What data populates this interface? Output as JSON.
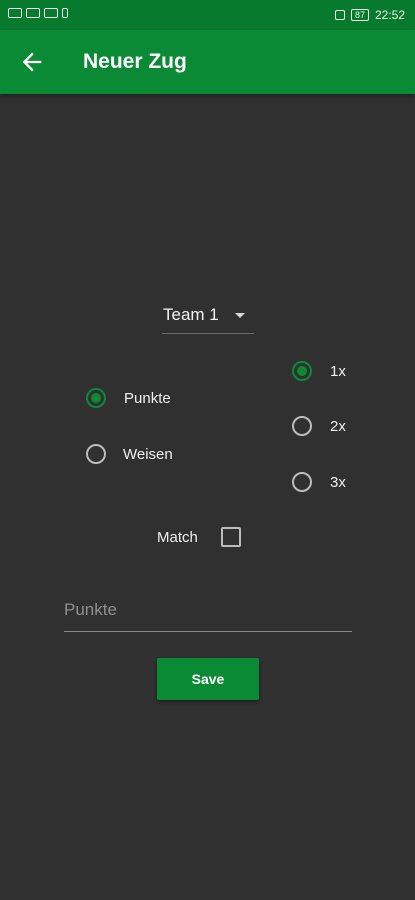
{
  "status_bar": {
    "time": "22:52",
    "battery": "87",
    "icons": [
      "sim-icon",
      "signal-icon",
      "wifi-icon",
      "bluetooth-icon",
      "mute-icon",
      "battery-icon"
    ]
  },
  "app_bar": {
    "title": "Neuer Zug",
    "back_icon": "arrow-back-icon"
  },
  "team_select": {
    "value": "Team 1"
  },
  "type_options": [
    {
      "label": "Punkte",
      "checked": true
    },
    {
      "label": "Weisen",
      "checked": false
    }
  ],
  "multiplier_options": [
    {
      "label": "1x",
      "checked": true
    },
    {
      "label": "2x",
      "checked": false
    },
    {
      "label": "3x",
      "checked": false
    }
  ],
  "match": {
    "label": "Match",
    "checked": false
  },
  "points_input": {
    "placeholder": "Punkte",
    "value": ""
  },
  "save_button": {
    "label": "Save"
  },
  "colors": {
    "primary": "#0b8a36",
    "status_bar": "#087a2d",
    "background": "#303030"
  }
}
